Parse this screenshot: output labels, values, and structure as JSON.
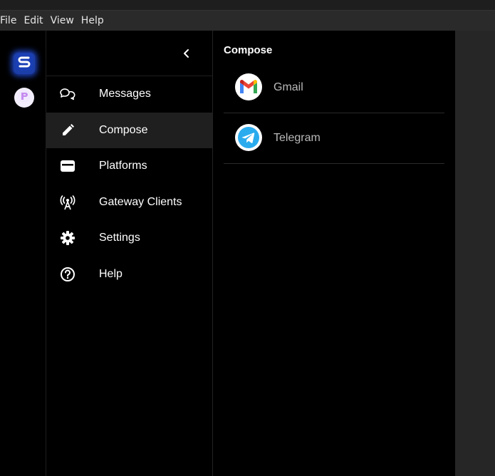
{
  "menubar": {
    "items": [
      {
        "label": "File"
      },
      {
        "label": "Edit"
      },
      {
        "label": "View"
      },
      {
        "label": "Help"
      }
    ]
  },
  "rail": {
    "apps": [
      {
        "icon": "smswithoutborders-logo-icon",
        "selected": true
      },
      {
        "icon": "relaysms-logo-icon",
        "selected": false
      }
    ]
  },
  "nav": {
    "collapse_icon": "chevron-left-icon",
    "items": [
      {
        "label": "Messages",
        "icon": "chat-bubbles-icon",
        "active": false
      },
      {
        "label": "Compose",
        "icon": "pencil-icon",
        "active": true
      },
      {
        "label": "Platforms",
        "icon": "card-icon",
        "active": false
      },
      {
        "label": "Gateway Clients",
        "icon": "antenna-icon",
        "active": false
      },
      {
        "label": "Settings",
        "icon": "gear-icon",
        "active": false
      },
      {
        "label": "Help",
        "icon": "question-circle-icon",
        "active": false
      }
    ]
  },
  "content": {
    "title": "Compose",
    "platforms": [
      {
        "name": "Gmail",
        "icon": "gmail-logo-icon"
      },
      {
        "name": "Telegram",
        "icon": "telegram-logo-icon",
        "color": "#2AABEE"
      }
    ]
  },
  "colors": {
    "accent_glow": "#285AFF",
    "active_nav_bg": "#1F1F1F",
    "telegram_blue": "#2AABEE"
  }
}
